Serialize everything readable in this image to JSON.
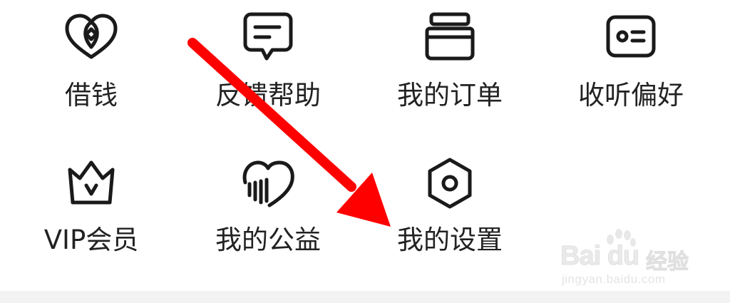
{
  "menu": {
    "items": [
      {
        "label": "借钱",
        "icon": "coin-hearts-icon"
      },
      {
        "label": "反馈帮助",
        "icon": "chat-bubble-icon"
      },
      {
        "label": "我的订单",
        "icon": "order-box-icon"
      },
      {
        "label": "收听偏好",
        "icon": "id-card-icon"
      },
      {
        "label": "VIP会员",
        "icon": "crown-icon"
      },
      {
        "label": "我的公益",
        "icon": "charity-heart-icon"
      },
      {
        "label": "我的设置",
        "icon": "settings-hexagon-icon"
      }
    ]
  },
  "annotation": {
    "icon": "red-arrow-icon",
    "color": "#ff0000"
  },
  "watermark": {
    "logo_text": "Bai du",
    "brand": "经验",
    "url": "jingyan.baidu.com"
  }
}
